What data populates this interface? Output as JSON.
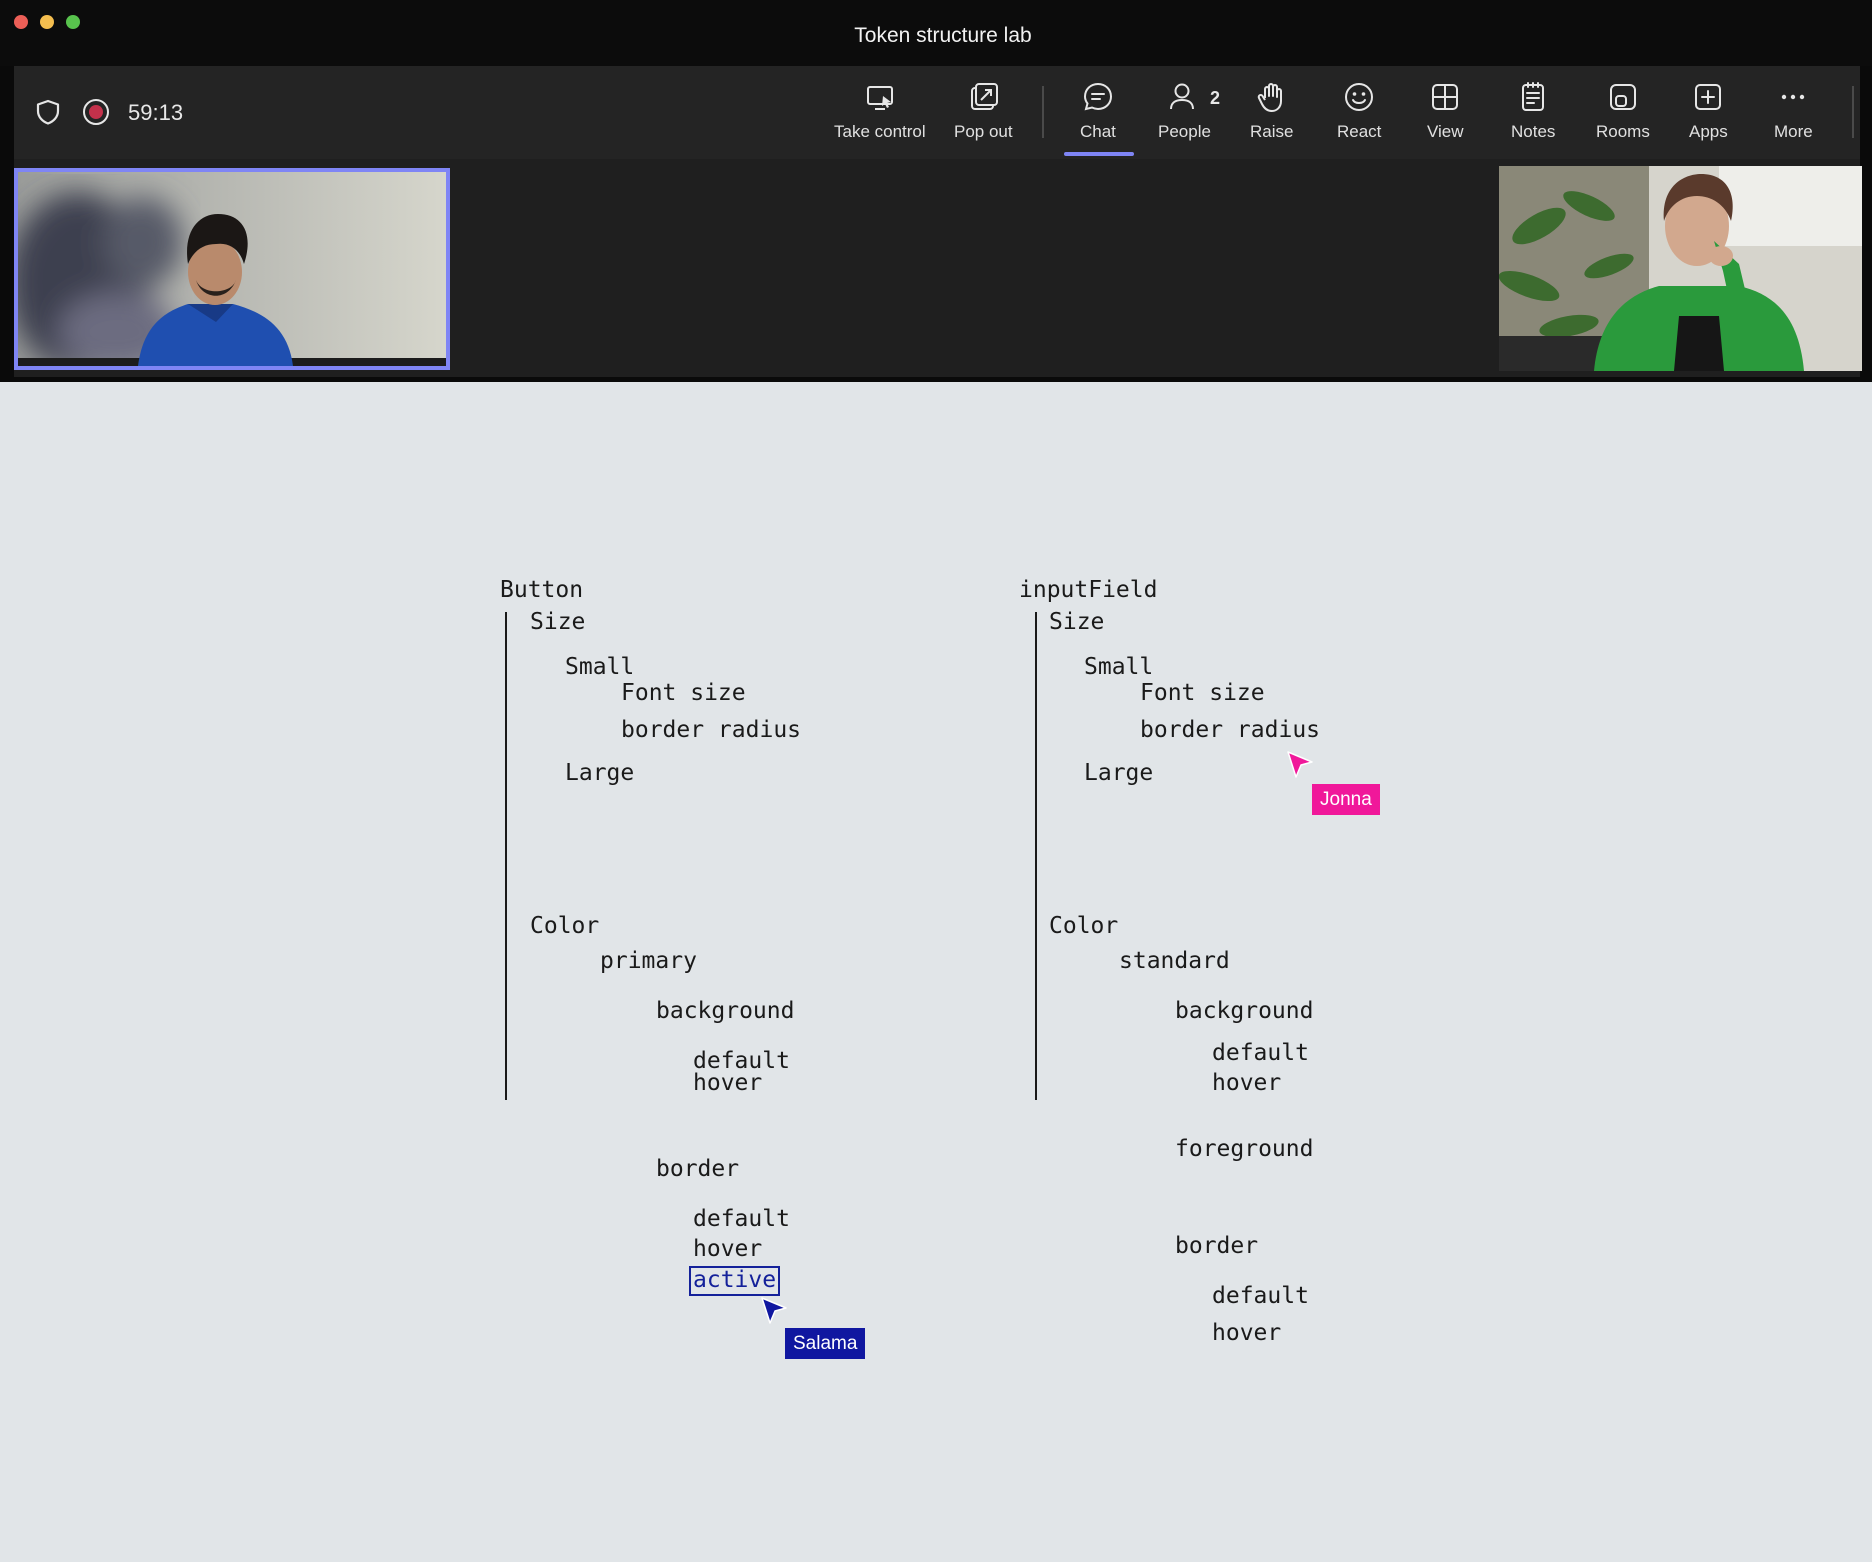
{
  "window": {
    "title": "Token structure lab"
  },
  "toolbar": {
    "timer": "59:13",
    "take_control": "Take control",
    "pop_out": "Pop out",
    "chat": "Chat",
    "people": "People",
    "people_count": "2",
    "raise": "Raise",
    "react": "React",
    "view": "View",
    "notes": "Notes",
    "rooms": "Rooms",
    "apps": "Apps",
    "more": "More"
  },
  "colors": {
    "accent": "#7f85f5",
    "cursor_jonna": "#f0189a",
    "cursor_salama": "#1017a0",
    "recording": "#c4314b"
  },
  "button_tree": {
    "root": "Button",
    "size": "Size",
    "small": "Small",
    "font_size": "Font size",
    "border_radius": "border radius",
    "large": "Large",
    "color": "Color",
    "primary": "primary",
    "background": "background",
    "bg_default": "default",
    "bg_hover": "hover",
    "border": "border",
    "border_default": "default",
    "border_hover": "hover",
    "border_active": "active"
  },
  "input_tree": {
    "root": "inputField",
    "size": "Size",
    "small": "Small",
    "font_size": "Font size",
    "border_radius": "border radius",
    "large": "Large",
    "color": "Color",
    "standard": "standard",
    "background": "background",
    "bg_default": "default",
    "bg_hover": "hover",
    "foreground": "foreground",
    "border": "border",
    "border_default": "default",
    "border_hover": "hover"
  },
  "cursors": {
    "jonna": "Jonna",
    "salama": "Salama"
  }
}
